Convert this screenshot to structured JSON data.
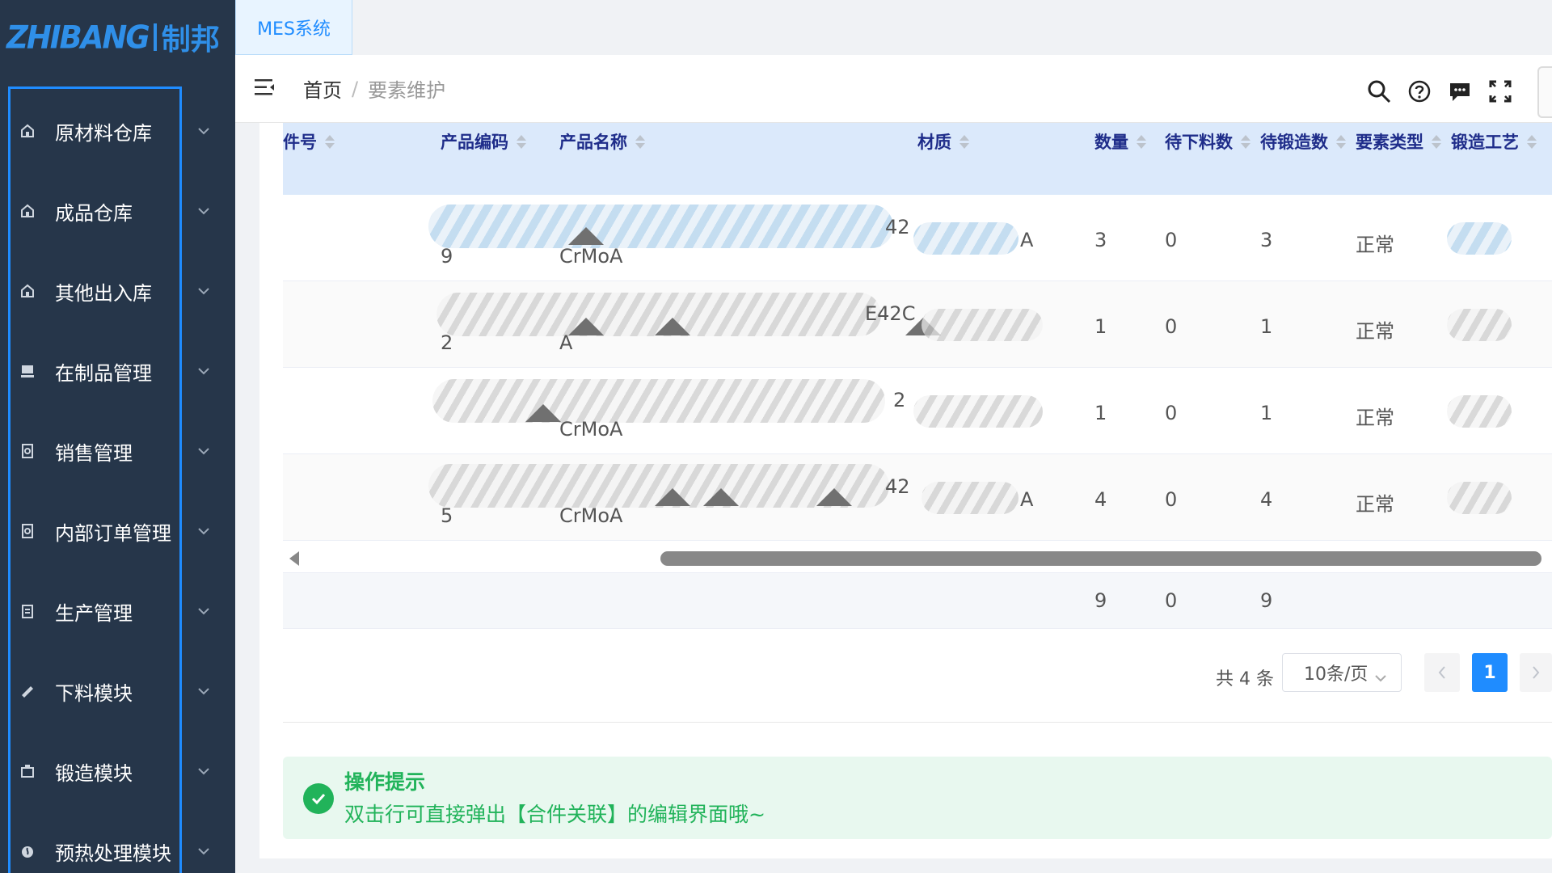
{
  "brand": {
    "logo_en": "ZHIBANG",
    "logo_cn": "制邦"
  },
  "sidebar": {
    "items": [
      {
        "label": "原材料仓库",
        "icon": "warehouse-icon"
      },
      {
        "label": "成品仓库",
        "icon": "warehouse-icon"
      },
      {
        "label": "其他出入库",
        "icon": "warehouse-icon"
      },
      {
        "label": "在制品管理",
        "icon": "monitor-icon"
      },
      {
        "label": "销售管理",
        "icon": "document-icon"
      },
      {
        "label": "内部订单管理",
        "icon": "document-icon"
      },
      {
        "label": "生产管理",
        "icon": "clipboard-icon"
      },
      {
        "label": "下料模块",
        "icon": "cutting-icon"
      },
      {
        "label": "锻造模块",
        "icon": "forging-icon"
      },
      {
        "label": "预热处理模块",
        "icon": "flame-icon"
      }
    ]
  },
  "tabs": [
    {
      "label": "MES系统"
    }
  ],
  "breadcrumb": {
    "home": "首页",
    "separator": "/",
    "current": "要素维护"
  },
  "table": {
    "columns": [
      "件号",
      "产品编码",
      "产品名称",
      "材质",
      "数量",
      "待下料数",
      "待锻造数",
      "要素类型",
      "锻造工艺"
    ],
    "rows": [
      {
        "code_tail": "9",
        "name_tail": "CrMoA",
        "name_frag": "42",
        "material_tail": "A",
        "qty": "3",
        "pending_cut": "0",
        "pending_forge": "3",
        "type": "正常"
      },
      {
        "code_tail": "2",
        "name_tail": "A",
        "name_frag": "E42C",
        "material_tail": "",
        "qty": "1",
        "pending_cut": "0",
        "pending_forge": "1",
        "type": "正常"
      },
      {
        "code_tail": "",
        "name_tail": "CrMoA",
        "name_frag": "2",
        "material_tail": "",
        "qty": "1",
        "pending_cut": "0",
        "pending_forge": "1",
        "type": "正常"
      },
      {
        "code_tail": "5",
        "name_tail": "CrMoA",
        "name_frag": "42",
        "material_tail": "A",
        "qty": "4",
        "pending_cut": "0",
        "pending_forge": "4",
        "type": "正常"
      }
    ],
    "summary": {
      "qty": "9",
      "pending_cut": "0",
      "pending_forge": "9"
    }
  },
  "pagination": {
    "total": "共 4 条",
    "page_size": "10条/页",
    "current_page": "1"
  },
  "tip": {
    "title": "操作提示",
    "text": "双击行可直接弹出【合件关联】的编辑界面哦~"
  },
  "colors": {
    "sidebar_bg": "#26364a",
    "accent": "#1f8cff",
    "header_row": "#dbe9fb",
    "success": "#21b35a"
  }
}
